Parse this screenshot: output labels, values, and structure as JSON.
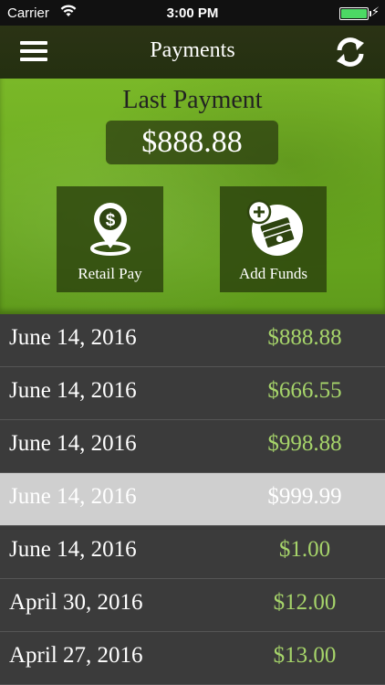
{
  "status_bar": {
    "carrier": "Carrier",
    "time": "3:00 PM"
  },
  "nav": {
    "title": "Payments",
    "menu_icon": "hamburger-menu-icon",
    "refresh_icon": "refresh-icon"
  },
  "hero": {
    "last_payment_label": "Last Payment",
    "last_payment_amount": "$888.88",
    "tiles": [
      {
        "label": "Retail Pay",
        "icon": "location-pin-dollar-icon"
      },
      {
        "label": "Add Funds",
        "icon": "add-money-icon"
      }
    ]
  },
  "payments": [
    {
      "date": "June 14, 2016",
      "amount": "$888.88",
      "selected": false
    },
    {
      "date": "June 14, 2016",
      "amount": "$666.55",
      "selected": false
    },
    {
      "date": "June 14, 2016",
      "amount": "$998.88",
      "selected": false
    },
    {
      "date": "June 14, 2016",
      "amount": "$999.99",
      "selected": true
    },
    {
      "date": "June 14, 2016",
      "amount": "$1.00",
      "selected": false
    },
    {
      "date": "April 30, 2016",
      "amount": "$12.00",
      "selected": false
    },
    {
      "date": "April 27, 2016",
      "amount": "$13.00",
      "selected": false
    }
  ],
  "colors": {
    "accent_green": "#6aaa1f",
    "amount_green": "#a6d46a",
    "nav_dark": "#2b3315"
  }
}
